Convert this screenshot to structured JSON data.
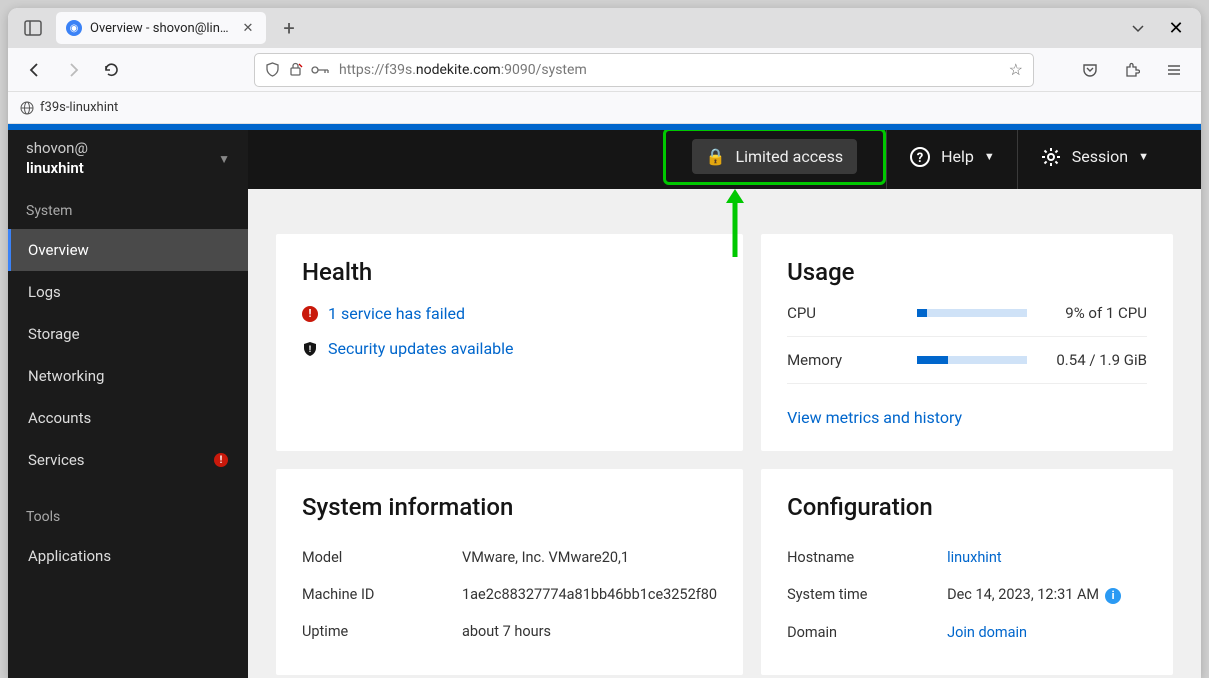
{
  "browser": {
    "tab_title": "Overview - shovon@linux",
    "url_plain_pre": "https://f39s.",
    "url_dark": "nodekite.com",
    "url_plain_post": ":9090/system",
    "bookmark": "f39s-linuxhint"
  },
  "sidebar": {
    "user_line1": "shovon@",
    "user_line2": "linuxhint",
    "group1": "System",
    "items": [
      "Overview",
      "Logs",
      "Storage",
      "Networking",
      "Accounts",
      "Services"
    ],
    "services_badge": "!",
    "group2": "Tools",
    "apps": "Applications"
  },
  "topbar": {
    "limited": "Limited access",
    "help": "Help",
    "session": "Session"
  },
  "health": {
    "title": "Health",
    "failed": "1 service has failed",
    "security": "Security updates available"
  },
  "usage": {
    "title": "Usage",
    "cpu_label": "CPU",
    "cpu_text": "9% of 1 CPU",
    "cpu_pct": 9,
    "mem_label": "Memory",
    "mem_text": "0.54 / 1.9 GiB",
    "mem_pct": 28,
    "metrics_link": "View metrics and history"
  },
  "sysinfo": {
    "title": "System information",
    "rows": [
      {
        "l": "Model",
        "v": "VMware, Inc. VMware20,1"
      },
      {
        "l": "Machine ID",
        "v": "1ae2c88327774a81bb46bb1ce3252f80"
      },
      {
        "l": "Uptime",
        "v": "about 7 hours"
      }
    ]
  },
  "config": {
    "title": "Configuration",
    "rows": [
      {
        "l": "Hostname",
        "v": "linuxhint"
      },
      {
        "l": "System time",
        "v": "Dec 14, 2023, 12:31 AM"
      },
      {
        "l": "Domain",
        "v": "Join domain"
      }
    ]
  }
}
